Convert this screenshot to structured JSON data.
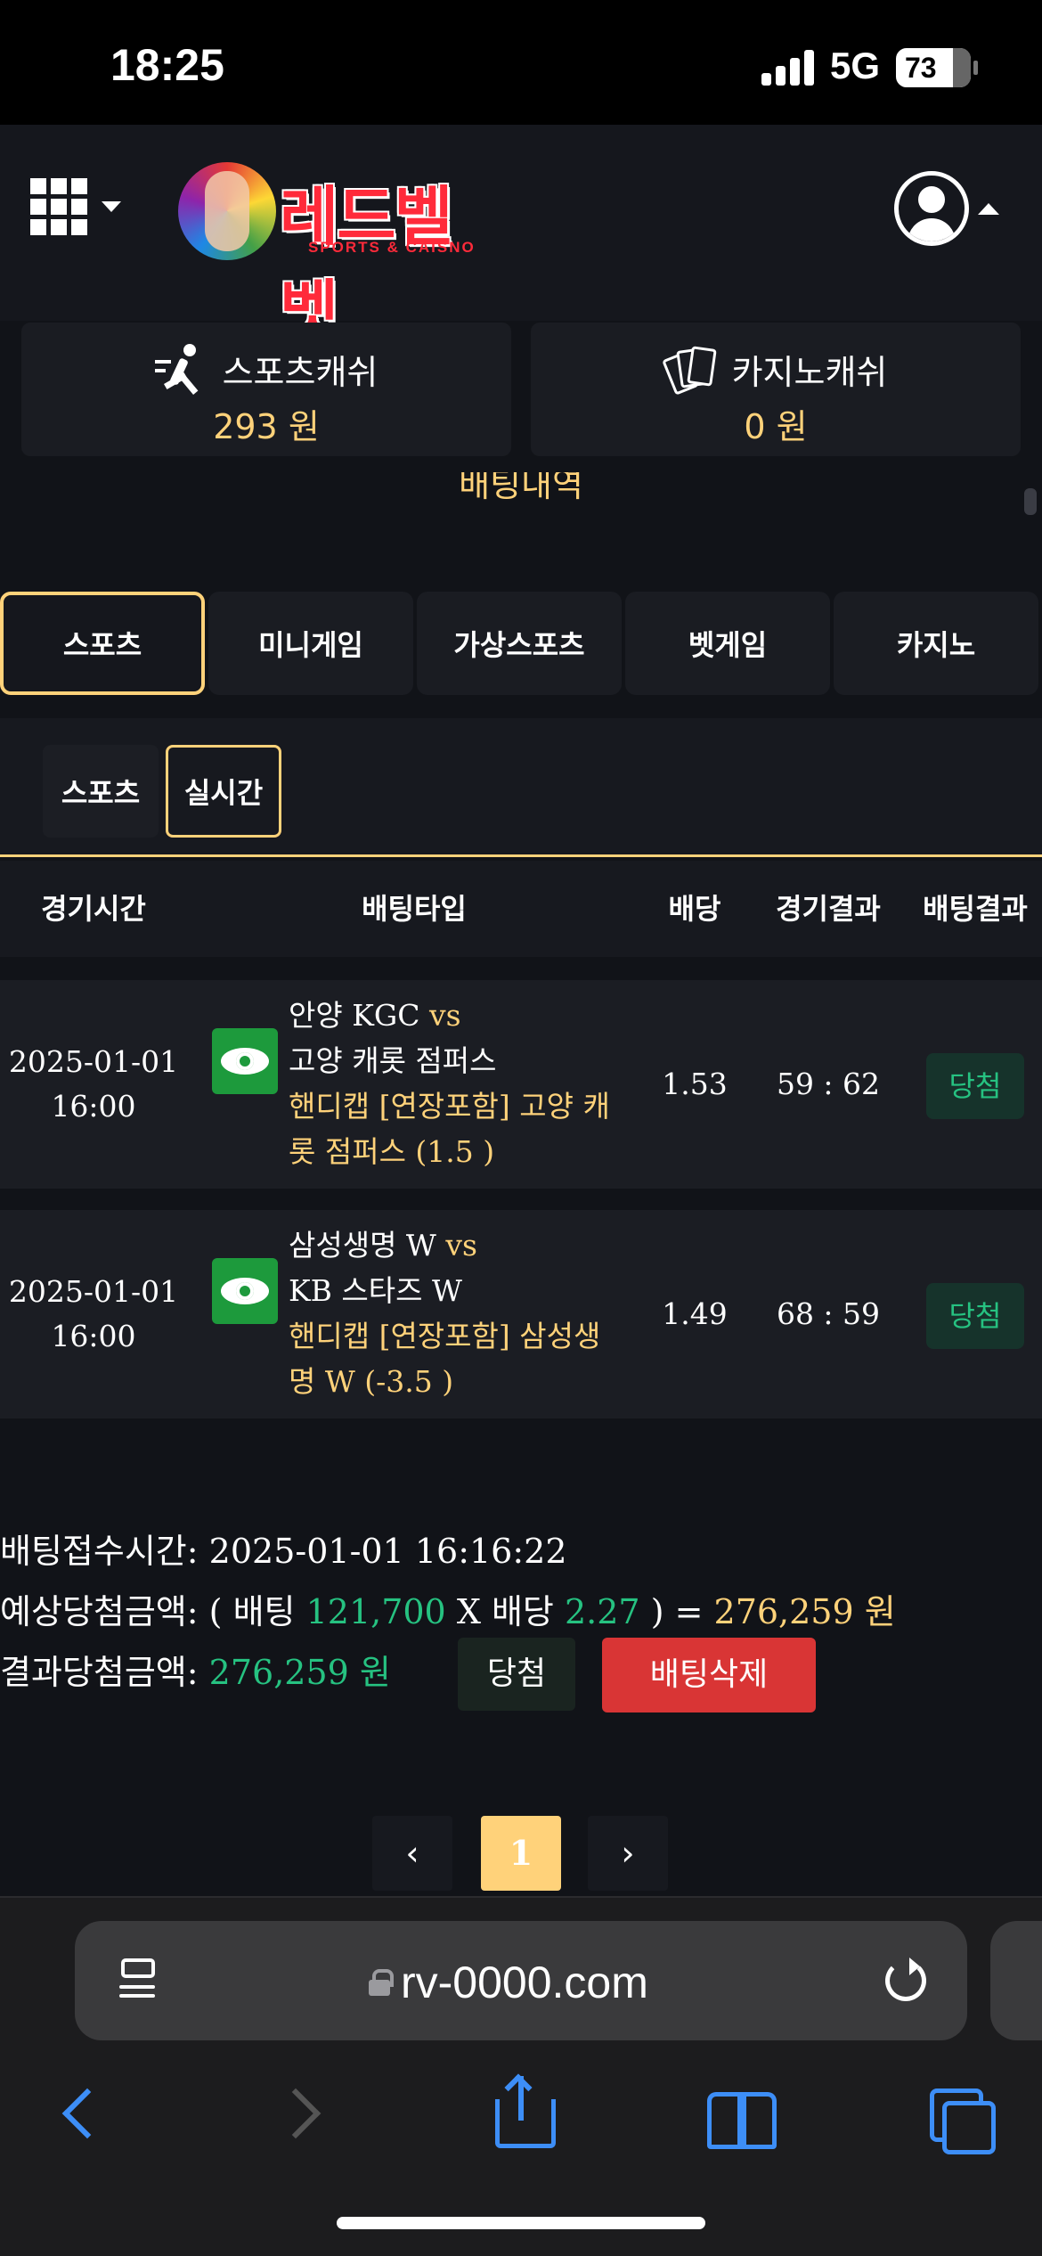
{
  "status_bar": {
    "time": "18:25",
    "network": "5G",
    "battery": "73"
  },
  "header": {
    "logo_text": "레드벨벳",
    "logo_sub": "SPORTS & CAISNO"
  },
  "cash": {
    "sports": {
      "label": "스포츠캐쉬",
      "value": "293 원",
      "icon": "runner-icon"
    },
    "casino": {
      "label": "카지노캐쉬",
      "value": "0 원",
      "icon": "cards-icon"
    }
  },
  "page": {
    "title": "배팅내역"
  },
  "category_tabs": [
    "스포츠",
    "미니게임",
    "가상스포츠",
    "벳게임",
    "카지노"
  ],
  "sub_tabs": [
    "스포츠",
    "실시간"
  ],
  "table": {
    "headers": [
      "경기시간",
      "배팅타입",
      "배당",
      "경기결과",
      "배팅결과"
    ],
    "rows": [
      {
        "date": "2025-01-01",
        "time": "16:00",
        "home": "안양 KGC",
        "vs": "vs",
        "away": "고양 캐롯 점퍼스",
        "pick": "핸디캡 [연장포함] 고양 캐롯 점퍼스 (1.5 )",
        "odds": "1.53",
        "score": "59 : 62",
        "result": "당첨"
      },
      {
        "date": "2025-01-01",
        "time": "16:00",
        "home": "삼성생명 W",
        "vs": "vs",
        "away": "KB 스타즈 W",
        "pick": "핸디캡 [연장포함] 삼성생명 W (-3.5 )",
        "odds": "1.49",
        "score": "68 : 59",
        "result": "당첨"
      }
    ]
  },
  "summary": {
    "received_label": "배팅접수시간:",
    "received_value": "2025-01-01 16:16:22",
    "expected_label": "예상당첨금액:",
    "expected_open": "( 배팅",
    "bet_amount": "121,700",
    "times": "X 배당",
    "total_odds": "2.27",
    "equals": ") =",
    "expected_value": "276,259 원",
    "result_label": "결과당첨금액:",
    "result_value": "276,259 원",
    "status_button": "당첨",
    "delete_button": "배팅삭제"
  },
  "pagination": {
    "prev": "‹",
    "current": "1",
    "next": "›"
  },
  "browser": {
    "url": "rv-0000.com"
  },
  "colors": {
    "accent": "#ffd27a",
    "win": "#26c281",
    "danger": "#d93535",
    "eye": "#1d9a3c",
    "ios_blue": "#3d8ef7"
  }
}
